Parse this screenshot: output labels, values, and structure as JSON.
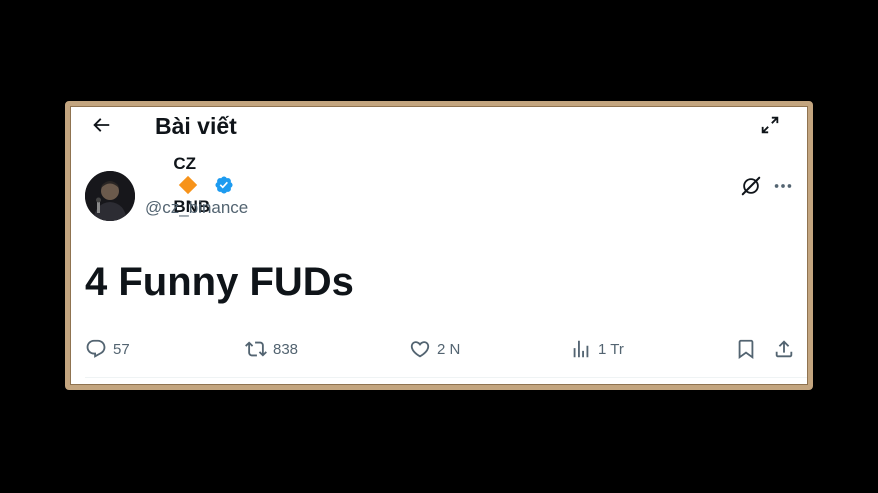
{
  "header": {
    "title": "Bài viết",
    "back_icon": "arrow-left-icon",
    "expand_icon": "expand-icon"
  },
  "tweet": {
    "display_name": "CZ 🔶 BNB",
    "display_name_text": "CZ",
    "display_name_suffix": "BNB",
    "handle": "@cz_binance",
    "text": "4 Funny FUDs",
    "verified_color": "#1d9bf0",
    "diamond_color": "#f7931a"
  },
  "actions": {
    "replies": "57",
    "reposts": "838",
    "likes": "2 N",
    "views": "1 Tr"
  },
  "colors": {
    "text_primary": "#0f1419",
    "text_secondary": "#536471",
    "frame_border": "#c3a57f",
    "background": "#000000"
  }
}
